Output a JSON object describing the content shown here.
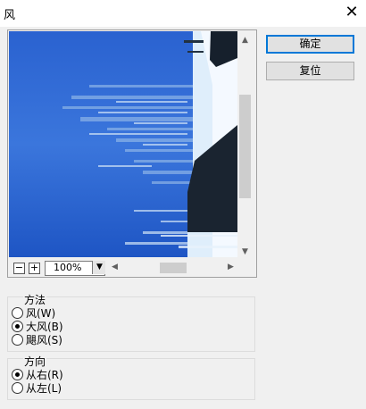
{
  "window": {
    "title": "风",
    "close_glyph": "✕"
  },
  "buttons": {
    "ok": "确定",
    "reset": "复位"
  },
  "zoom": {
    "value": "100%",
    "minus": "−",
    "plus": "+",
    "dropdown_icon": "chevron-down-icon"
  },
  "method": {
    "legend": "方法",
    "options": [
      "风(W)",
      "大风(B)",
      "飓风(S)"
    ],
    "selected": 1
  },
  "direction": {
    "legend": "方向",
    "options": [
      "从右(R)",
      "从左(L)"
    ],
    "selected": 0
  },
  "colors": {
    "sky": "#1e55c4",
    "building": "#1a2430",
    "accent": "#0078d7"
  }
}
